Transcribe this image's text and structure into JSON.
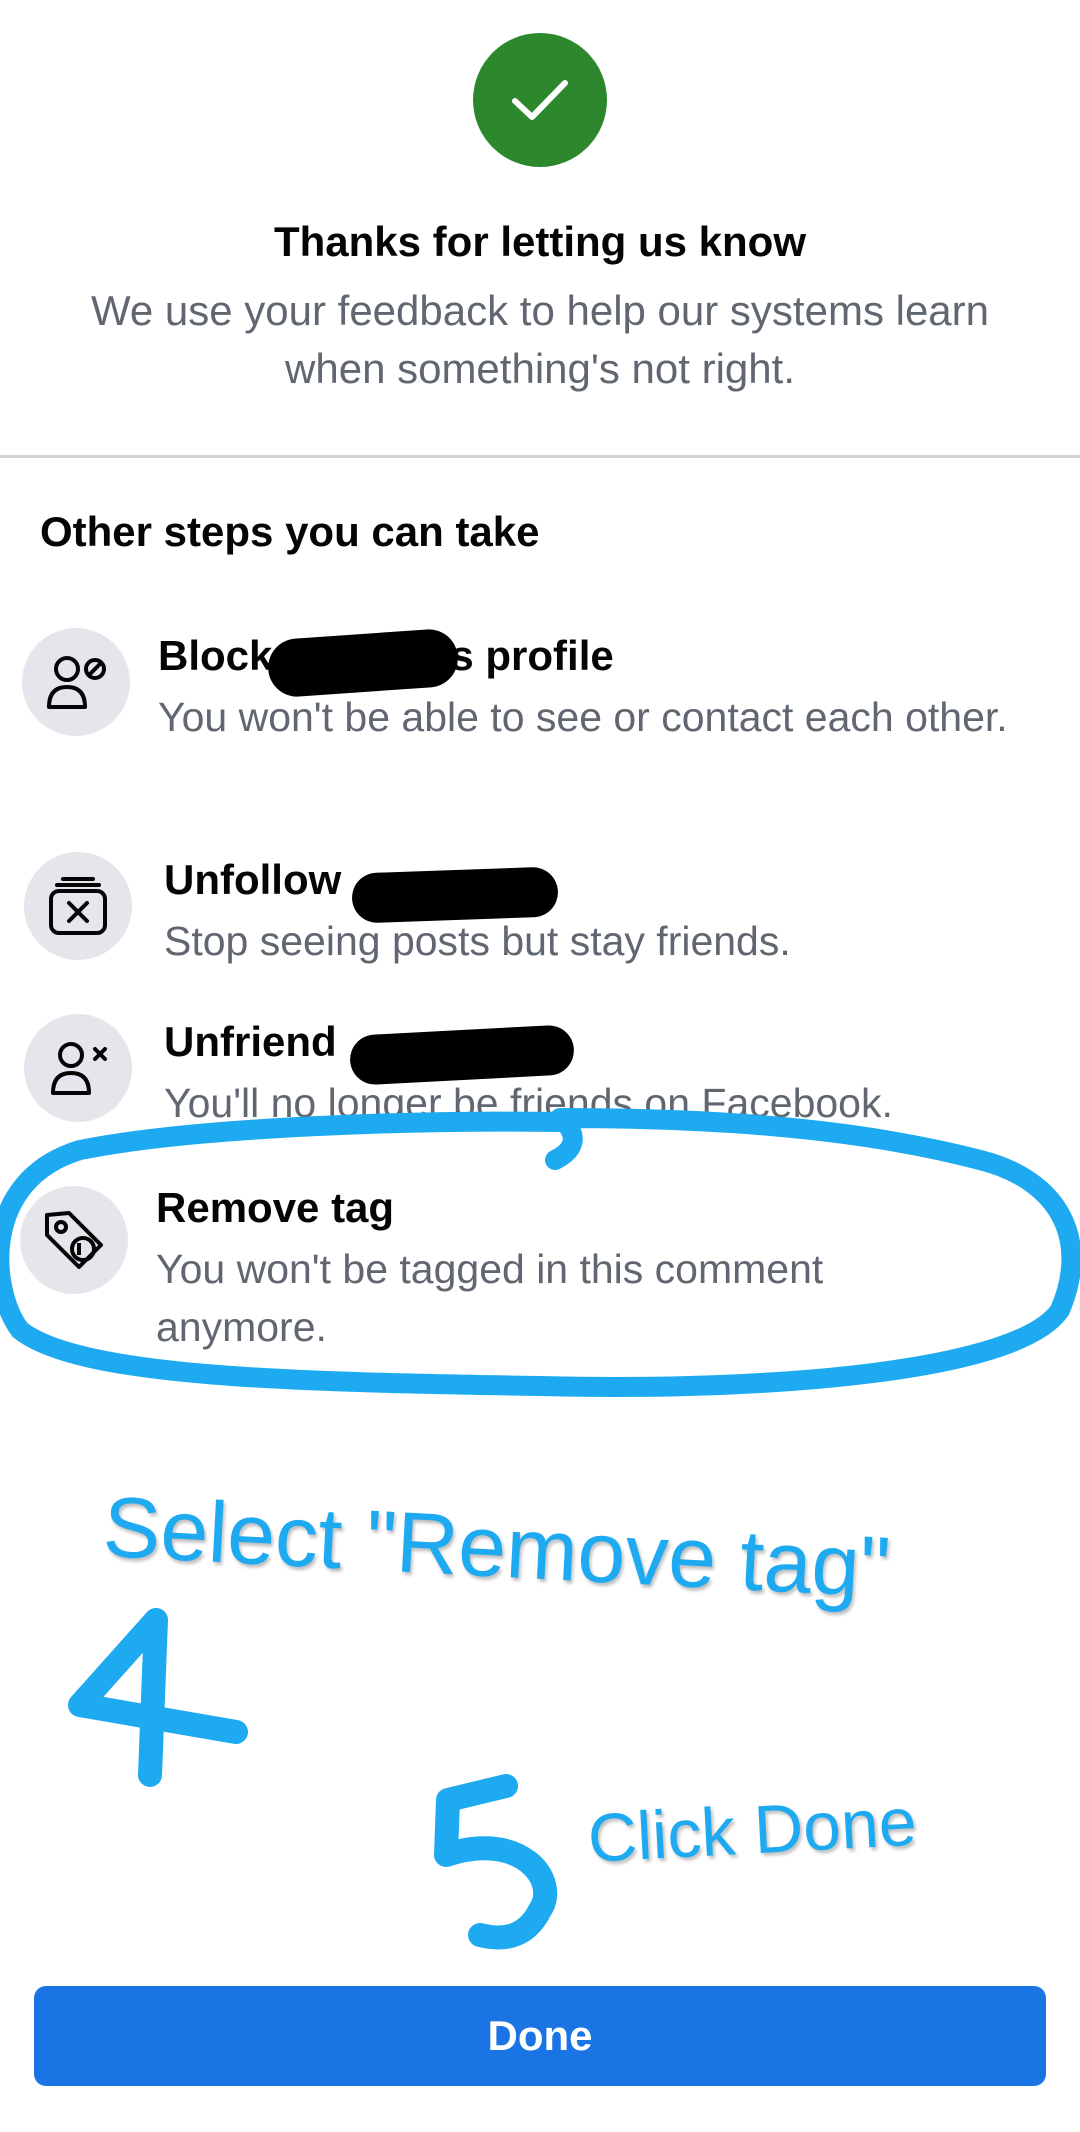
{
  "header": {
    "icon": "checkmark-icon",
    "accent_color": "#2d882d",
    "title": "Thanks for letting us know",
    "subtitle": "We use your feedback to help our systems learn when something's not right."
  },
  "section": {
    "title": "Other steps you can take"
  },
  "options": [
    {
      "id": "block",
      "icon": "block-person-icon",
      "title_prefix": "Block",
      "title_suffix": "s profile",
      "description": "You won't be able to see or contact each other."
    },
    {
      "id": "unfollow",
      "icon": "unfollow-icon",
      "title_prefix": "Unfollow",
      "description": "Stop seeing posts but stay friends."
    },
    {
      "id": "unfriend",
      "icon": "unfriend-icon",
      "title_prefix": "Unfriend",
      "description": "You'll no longer be friends on Facebook."
    },
    {
      "id": "remove-tag",
      "icon": "tag-remove-icon",
      "title": "Remove tag",
      "description": "You won't be tagged in this comment anymore."
    }
  ],
  "annotations": {
    "color": "#1eaaf1",
    "step4_text": "Select \"Remove tag\"",
    "step4_number": "4",
    "step5_text": "Click Done",
    "step5_number": "5"
  },
  "footer": {
    "done_label": "Done",
    "button_color": "#1b74e4"
  }
}
